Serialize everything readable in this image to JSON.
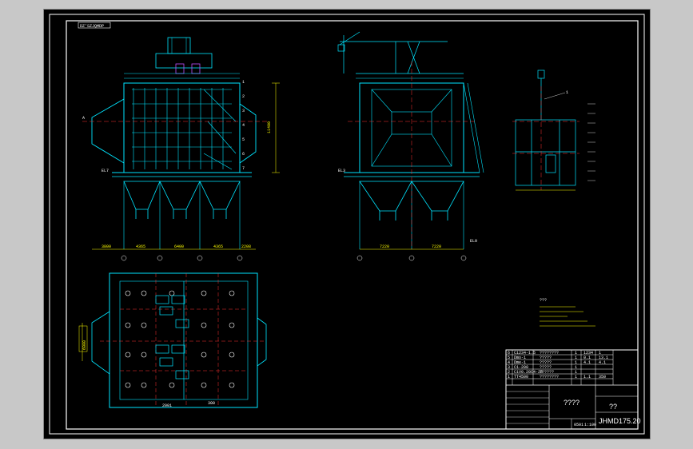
{
  "drawing": {
    "label_tag": "DZ'SZJQMDP",
    "drawing_no": "JHMD175.20",
    "scale": "1:100",
    "sheet_title": "????",
    "short_title": "??",
    "sheet_code": "0501",
    "notes_title": "???"
  },
  "front_view": {
    "dims_bottom": [
      "3800",
      "4365",
      "6400",
      "4365",
      "2208"
    ],
    "height_dim": "11400",
    "left_mark": "A",
    "side_tags": [
      "1",
      "2",
      "3",
      "4",
      "5",
      "6",
      "7"
    ],
    "level_tag": "EL7"
  },
  "side_view": {
    "dims_bottom": [
      "7220",
      "7220"
    ],
    "level_tag": "EL3",
    "right_tag": "EL0"
  },
  "plan_view": {
    "width_dim": "6000",
    "bottom_tags": [
      "2001",
      "300"
    ]
  },
  "detail_view": {
    "callout": "1"
  },
  "title_block": {
    "rows": [
      [
        "6",
        "C1234-1.5",
        "????????",
        "1",
        "1234",
        "1"
      ],
      [
        "5",
        "Dmo-1",
        "?????",
        "1",
        "0.1",
        "13.1"
      ],
      [
        "4",
        "Dme-1",
        "?????",
        "1",
        "4.1",
        "4.1"
      ],
      [
        "3",
        "C1-200",
        "?????",
        "1",
        "",
        ""
      ],
      [
        "2",
        "C1V0.20C4-25",
        "??????",
        "1",
        "",
        ""
      ],
      [
        "1",
        "TT4500",
        "????????",
        "1",
        "1.1",
        "350"
      ]
    ]
  },
  "colors": {
    "structure": "#00e5ff",
    "frame": "#ffffff",
    "center": "#ff3030",
    "dimension": "#ffff00",
    "equipment": "#c050ff",
    "hatch": "#00ff66"
  }
}
